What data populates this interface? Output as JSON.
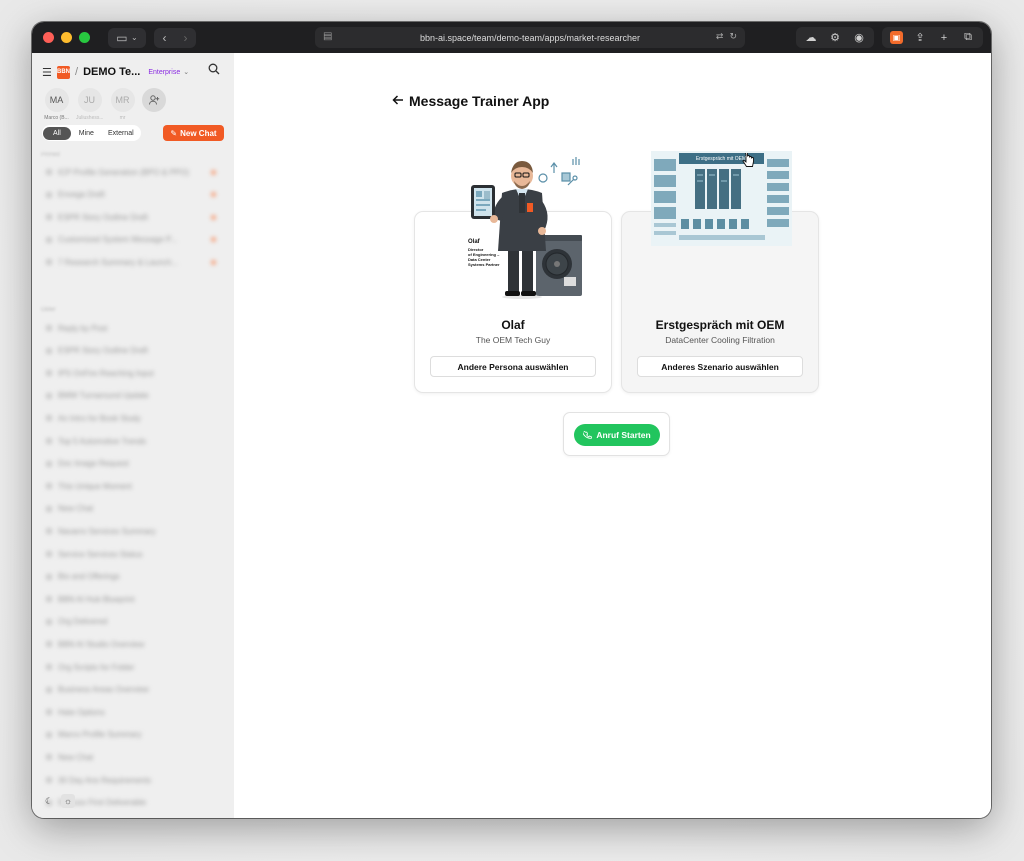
{
  "browser": {
    "url": "bbn-ai.space/team/demo-team/apps/market-researcher"
  },
  "sidebar": {
    "team_name": "DEMO Te...",
    "plan": "Enterprise",
    "logo_text": "BBN",
    "avatars": [
      {
        "initials": "MA",
        "name": "Marco (B..."
      },
      {
        "initials": "JU",
        "name": "Juliushess..."
      },
      {
        "initials": "MR",
        "name": "mr"
      }
    ],
    "filters": [
      "All",
      "Mine",
      "External"
    ],
    "new_chat_label": "New Chat",
    "pinned_label": "Pinned",
    "pinned": [
      "ICP Profile Generation (BPO & PPO)",
      "Envega Draft",
      "ESPR Story Outline Draft",
      "Customized System Message P...",
      "7 Research Summary & Launch..."
    ],
    "older_label": "Older",
    "older": [
      "Reply by Post",
      "ESPR Story Outline Draft",
      "IPS OnFire Reaching Input",
      "BMW Turnaround Update",
      "An Intro for Book Study",
      "Top 5 Automotive Trends",
      "Doc Image Request",
      "This Unique Moment",
      "New Chat",
      "Navarro Services Summary",
      "Service Services Status",
      "Bio and Offerings",
      "BBN AI Hub Blueprint",
      "Org Delivered",
      "BBN AI Studio Overview",
      "Org Scripts for Folder",
      "Business Areas Overview",
      "Hate Options",
      "Marco Profile Summary",
      "New Chat",
      "30 Day Ans Requirements",
      "Discuss First Deliverable"
    ]
  },
  "main": {
    "page_title": "Message Trainer App",
    "persona": {
      "name": "Olaf",
      "subtitle": "The OEM Tech Guy",
      "button": "Andere Persona auswählen",
      "image_caption": [
        "Olaf",
        "Director",
        "of Engineering –",
        "Data Center",
        "Systems Partner"
      ]
    },
    "scenario": {
      "name": "Erstgespräch mit OEM",
      "subtitle": "DataCenter Cooling Filtration",
      "button": "Anderes Szenario auswählen",
      "image_caption": "Erstgespräch mit OEM"
    },
    "call_button": "Anruf Starten"
  },
  "colors": {
    "accent": "#f15a24",
    "plan": "#8a2be2",
    "call": "#22c55e",
    "titlebar": "#1f1f21",
    "sidebar_bg": "#efefef"
  }
}
